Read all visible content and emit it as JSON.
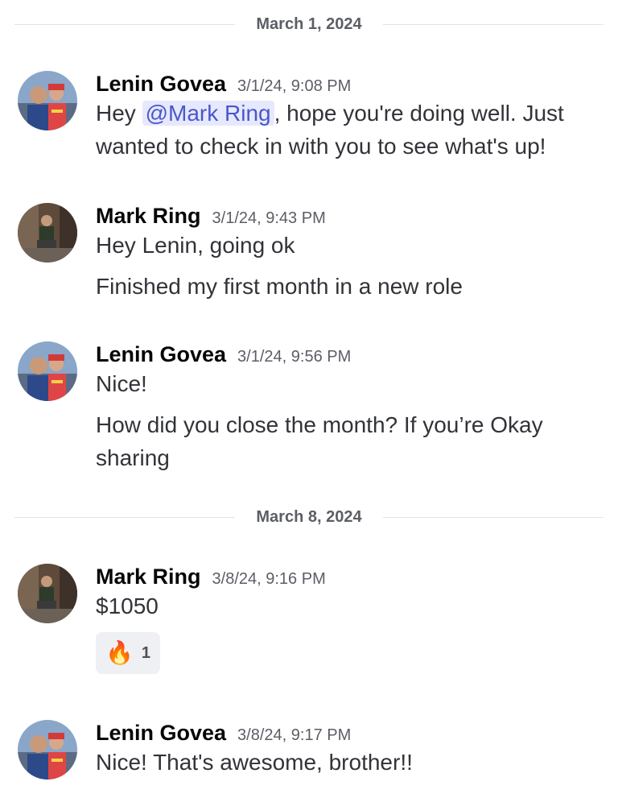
{
  "dividers": [
    "March 1, 2024",
    "March 8, 2024"
  ],
  "messages": [
    {
      "author": "Lenin Govea",
      "time": "3/1/24, 9:08 PM",
      "pre_mention": "Hey ",
      "mention": "@Mark Ring",
      "post_mention": ", hope you're doing well. Just",
      "line2": "wanted to check in with you to see what's up!"
    },
    {
      "author": "Mark Ring",
      "time": "3/1/24, 9:43 PM",
      "lines": [
        "Hey Lenin, going ok",
        "Finished my first month in a new role"
      ]
    },
    {
      "author": "Lenin Govea",
      "time": "3/1/24, 9:56 PM",
      "lines": [
        "Nice!",
        "How did you close the month? If you’re Okay",
        "sharing"
      ]
    },
    {
      "author": "Mark Ring",
      "time": "3/8/24, 9:16 PM",
      "lines": [
        "$1050"
      ],
      "reaction": {
        "emoji": "🔥",
        "emoji_name": "fire-emoji",
        "count": "1"
      }
    },
    {
      "author": "Lenin Govea",
      "time": "3/8/24, 9:17 PM",
      "lines": [
        "Nice! That's awesome, brother!!"
      ]
    }
  ],
  "colors": {
    "mention_bg": "#e6e8fd",
    "mention_text": "#4a58c9",
    "divider_line": "#e1e3e6",
    "timestamp": "#5c5e66"
  }
}
